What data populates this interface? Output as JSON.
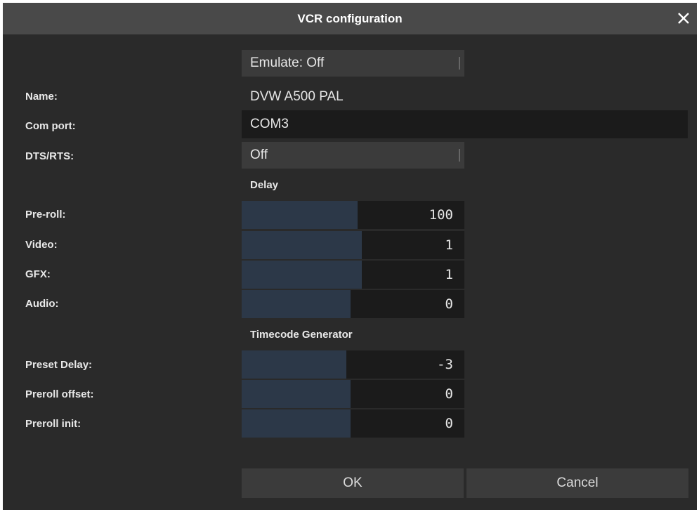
{
  "window": {
    "title": "VCR configuration"
  },
  "emulate": {
    "value": "Emulate: Off"
  },
  "fields": {
    "name_label": "Name:",
    "name_value": "DVW A500 PAL",
    "com_port_label": "Com port:",
    "com_port_value": "COM3",
    "dts_rts_label": "DTS/RTS:",
    "dts_rts_value": "Off"
  },
  "delay": {
    "title": "Delay",
    "preroll_label": "Pre-roll:",
    "preroll_value": "100",
    "preroll_fill": 0.52,
    "video_label": "Video:",
    "video_value": "1",
    "video_fill": 0.54,
    "gfx_label": "GFX:",
    "gfx_value": "1",
    "gfx_fill": 0.54,
    "audio_label": "Audio:",
    "audio_value": "0",
    "audio_fill": 0.49
  },
  "timecode": {
    "title": "Timecode Generator",
    "preset_delay_label": "Preset Delay:",
    "preset_delay_value": "-3",
    "preset_delay_fill": 0.47,
    "preroll_offset_label": "Preroll offset:",
    "preroll_offset_value": "0",
    "preroll_offset_fill": 0.49,
    "preroll_init_label": "Preroll init:",
    "preroll_init_value": "0",
    "preroll_init_fill": 0.49
  },
  "buttons": {
    "ok": "OK",
    "cancel": "Cancel"
  },
  "icons": {
    "close": "close-icon",
    "dropdown_tick": "dropdown-indicator-icon"
  },
  "colors": {
    "titlebar": "#494949",
    "background": "#2a2a2a",
    "slider_fill": "#2c3848"
  }
}
